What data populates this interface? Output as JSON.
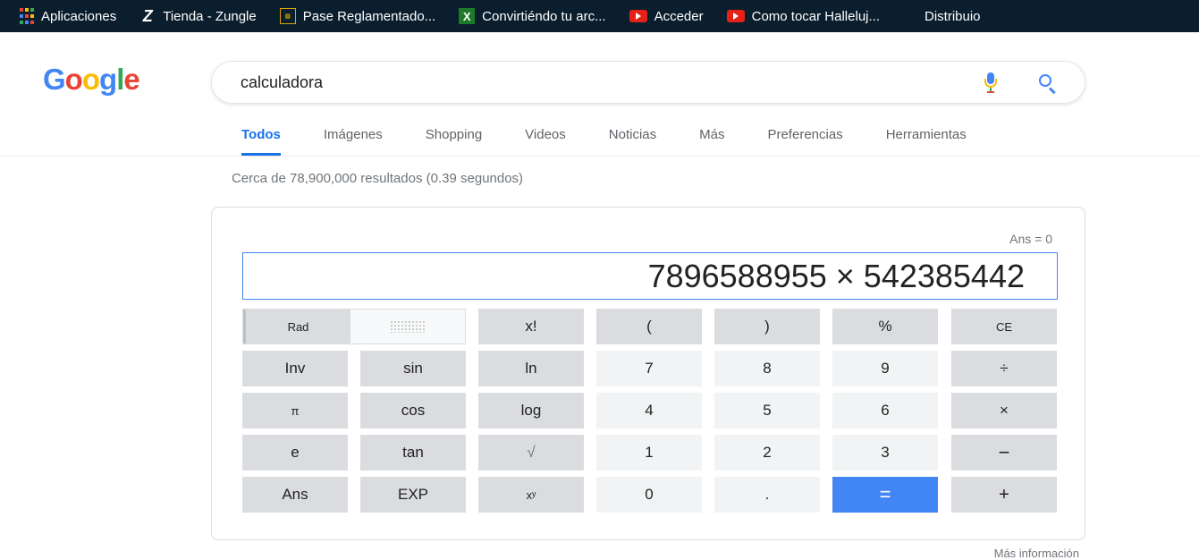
{
  "bookmarks": [
    {
      "label": "Aplicaciones",
      "icon": "apps-grid-icon"
    },
    {
      "label": "Tienda - Zungle",
      "icon": "zungle-z-icon"
    },
    {
      "label": "Pase Reglamentado...",
      "icon": "unam-icon"
    },
    {
      "label": "Convirtiéndo tu arc...",
      "icon": "excel-x-icon"
    },
    {
      "label": "Acceder",
      "icon": "youtube-icon"
    },
    {
      "label": "Como tocar Halleluj...",
      "icon": "youtube-icon"
    },
    {
      "label": "Distribuio",
      "icon": ""
    }
  ],
  "logo": [
    "G",
    "o",
    "o",
    "g",
    "l",
    "e"
  ],
  "search": {
    "query": "calculadora"
  },
  "tabs": [
    "Todos",
    "Imágenes",
    "Shopping",
    "Videos",
    "Noticias",
    "Más",
    "Preferencias",
    "Herramientas"
  ],
  "stats": "Cerca de 78,900,000 resultados (0.39 segundos)",
  "calculator": {
    "ans": "Ans = 0",
    "display": "7896588955 × 542385442",
    "rad": "Rad",
    "keys": [
      [
        "x!",
        "(",
        ")",
        "%",
        "CE"
      ],
      [
        "Inv",
        "sin",
        "ln",
        "7",
        "8",
        "9",
        "÷"
      ],
      [
        "π",
        "cos",
        "log",
        "4",
        "5",
        "6",
        "×"
      ],
      [
        "e",
        "tan",
        "√",
        "1",
        "2",
        "3",
        "−"
      ],
      [
        "Ans",
        "EXP",
        "xʸ",
        "0",
        ".",
        "=",
        "+"
      ]
    ]
  },
  "more_info": "Más información",
  "colors": {
    "accent": "#4285f4",
    "bookmark_bar": "#0a1e2e"
  }
}
